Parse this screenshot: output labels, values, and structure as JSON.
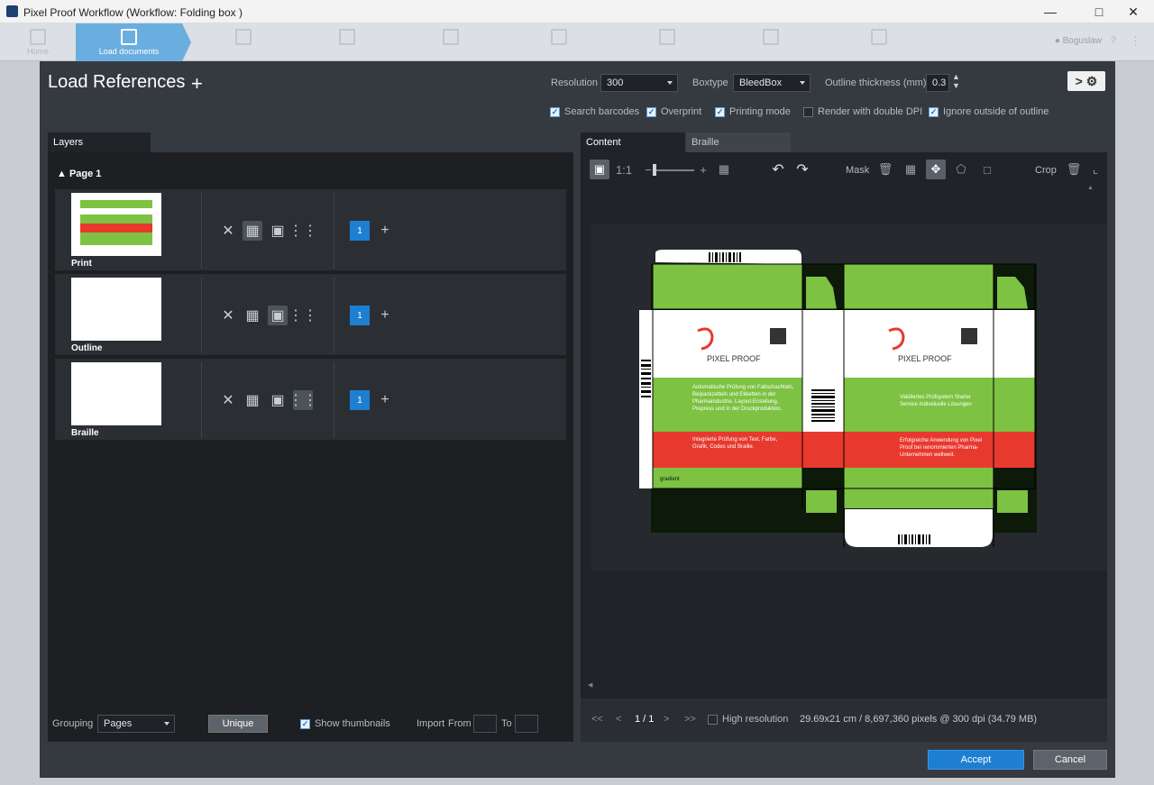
{
  "window": {
    "title": "Pixel Proof Workflow (Workflow: Folding box )"
  },
  "nav": {
    "home": "Home",
    "load": "Load documents",
    "user": "Boguslaw",
    "help": "?"
  },
  "header": {
    "title": "Load References",
    "resolution_label": "Resolution",
    "resolution_value": "300",
    "boxtype_label": "Boxtype",
    "boxtype_value": "BleedBox",
    "outline_label": "Outline thickness (mm)",
    "outline_value": "0.3"
  },
  "options": [
    {
      "label": "Search barcodes",
      "checked": true
    },
    {
      "label": "Overprint",
      "checked": true
    },
    {
      "label": "Printing mode",
      "checked": true
    },
    {
      "label": "Render with double DPI",
      "checked": false
    },
    {
      "label": "Ignore outside of outline",
      "checked": true
    }
  ],
  "layers": {
    "tab": "Layers",
    "page": "Page 1",
    "rows": [
      {
        "name": "Print",
        "count": "1"
      },
      {
        "name": "Outline",
        "count": "1"
      },
      {
        "name": "Braille",
        "count": "1"
      }
    ]
  },
  "bottom": {
    "grouping_label": "Grouping",
    "grouping_value": "Pages",
    "unique": "Unique",
    "show_thumbnails": "Show thumbnails",
    "import_label": "Import",
    "from_label": "From",
    "to_label": "To"
  },
  "preview": {
    "tab_content": "Content",
    "tab_braille": "Braille",
    "mask_label": "Mask",
    "crop_label": "Crop",
    "page_indicator": "1 / 1",
    "high_resolution": "High resolution",
    "info": "29.69x21 cm / 8,697,360 pixels @ 300 dpi (34.79 MB)"
  },
  "artwork": {
    "brand": "PIXEL PROOF",
    "text_de_1": "Automatische Prüfung von Faltschachteln, Beipackzetteln und Etiketten in der Pharmaindustrie, Layout-Erstellung, Prepress und in der Druckproduktion.",
    "text_de_2": "Integrierte Prüfung von Text, Farbe, Grafik, Codes und Braille.",
    "text_right_1": "Validiertes Prüfsystem Starter Service Individuelle Lösungen",
    "text_right_2": "Erfolgreiche Anwendung von Pixel Proof bei renommierten Pharma-Unternehmen weltweit.",
    "gradient": "gradient"
  },
  "footer": {
    "accept": "Accept",
    "cancel": "Cancel"
  },
  "colors": {
    "accent": "#1e7fd1",
    "green": "#7dc242",
    "red": "#e8392e"
  }
}
